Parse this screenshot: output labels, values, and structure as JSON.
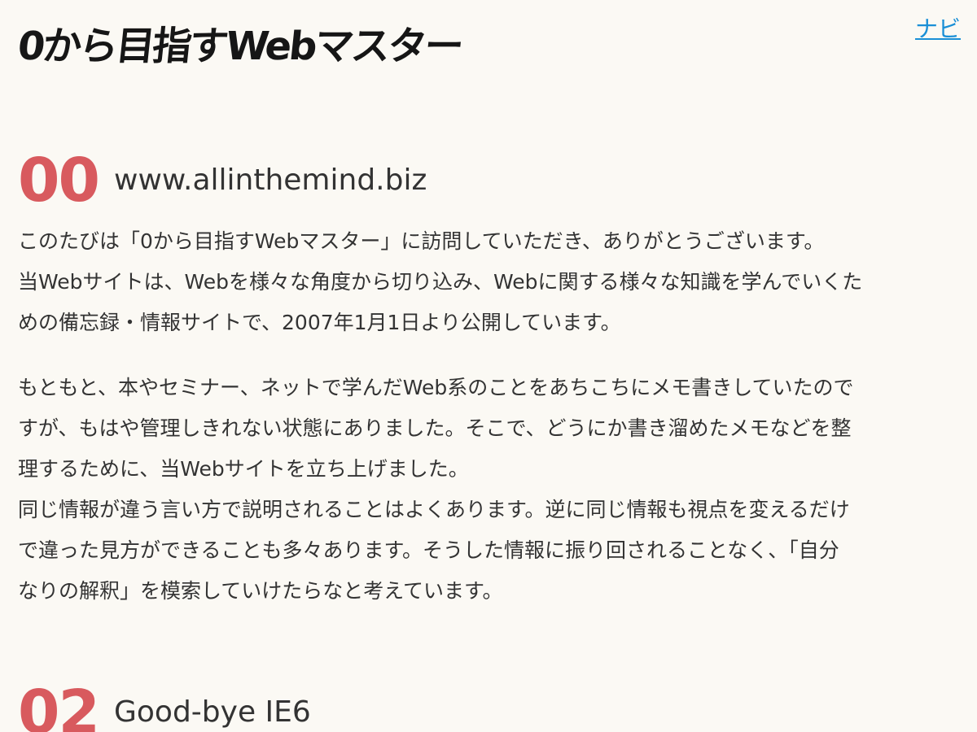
{
  "header": {
    "logo_text": "0から目指すWebマスター",
    "nav_label": "ナビ"
  },
  "sections": [
    {
      "number": "00",
      "title": "www.allinthemind.biz",
      "lines_p1": [
        "このたびは「0から目指すWebマスター」に訪問していただき、ありがとうございます。",
        "当Webサイトは、Webを様々な角度から切り込み、Webに関する様々な知識を学んでいくた",
        "めの備忘録・情報サイトで、2007年1月1日より公開しています。"
      ],
      "lines_p2": [
        "もともと、本やセミナー、ネットで学んだWeb系のことをあちこちにメモ書きしていたので",
        "すが、もはや管理しきれない状態にありました。そこで、どうにか書き溜めたメモなどを整",
        "理するために、当Webサイトを立ち上げました。",
        "同じ情報が違う言い方で説明されることはよくあります。逆に同じ情報も視点を変えるだけ",
        "で違った見方ができることも多々あります。そうした情報に振り回されることなく、「自分",
        "なりの解釈」を模索していけたらなと考えています。"
      ]
    },
    {
      "number": "02",
      "title": "Good-bye IE6"
    }
  ],
  "colors": {
    "background": "#fbf9f4",
    "accent_number": "#d85a5e",
    "link": "#1a8fd6",
    "text": "#333333"
  }
}
